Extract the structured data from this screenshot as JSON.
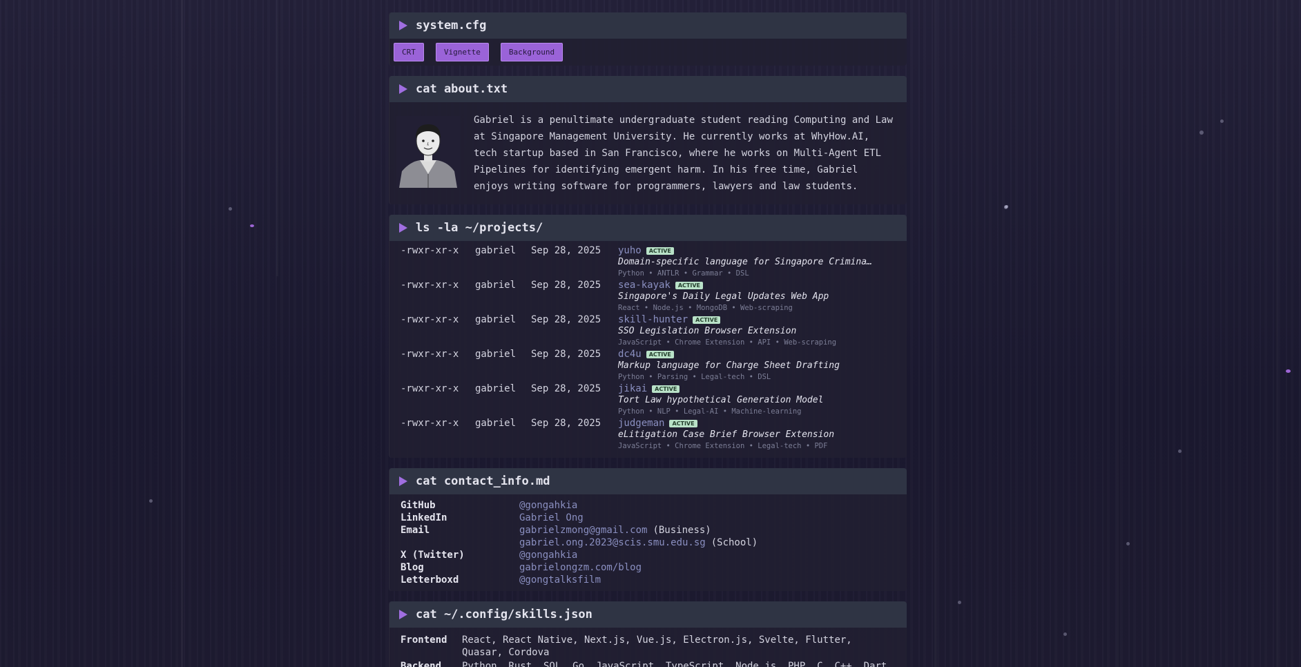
{
  "system_cfg": {
    "title": "system.cfg",
    "buttons": [
      {
        "label": "CRT"
      },
      {
        "label": "Vignette"
      },
      {
        "label": "Background"
      }
    ]
  },
  "about": {
    "title": "cat about.txt",
    "avatar_icon": "avatar-sketch",
    "text": "Gabriel is a penultimate undergraduate student reading Computing and Law at Singapore Management University. He currently works at WhyHow.AI, tech startup based in San Francisco, where he works on Multi-Agent ETL Pipelines for identifying emergent harm. In his free time, Gabriel enjoys writing software for programmers, lawyers and law students."
  },
  "projects": {
    "title": "ls -la ~/projects/",
    "badge_label": "ACTIVE",
    "rows": [
      {
        "perm": "-rwxr-xr-x",
        "owner": "gabriel",
        "date": "Sep 28, 2025",
        "name": "yuho",
        "desc": "Domain-specific language for Singapore Criminal Law",
        "tags": "Python • ANTLR • Grammar • DSL"
      },
      {
        "perm": "-rwxr-xr-x",
        "owner": "gabriel",
        "date": "Sep 28, 2025",
        "name": "sea-kayak",
        "desc": "Singapore's Daily Legal Updates Web App",
        "tags": "React • Node.js • MongoDB • Web-scraping"
      },
      {
        "perm": "-rwxr-xr-x",
        "owner": "gabriel",
        "date": "Sep 28, 2025",
        "name": "skill-hunter",
        "desc": "SSO Legislation Browser Extension",
        "tags": "JavaScript • Chrome Extension • API • Web-scraping"
      },
      {
        "perm": "-rwxr-xr-x",
        "owner": "gabriel",
        "date": "Sep 28, 2025",
        "name": "dc4u",
        "desc": "Markup language for Charge Sheet Drafting",
        "tags": "Python • Parsing • Legal-tech • DSL"
      },
      {
        "perm": "-rwxr-xr-x",
        "owner": "gabriel",
        "date": "Sep 28, 2025",
        "name": "jikai",
        "desc": "Tort Law hypothetical Generation Model",
        "tags": "Python • NLP • Legal-AI • Machine-learning"
      },
      {
        "perm": "-rwxr-xr-x",
        "owner": "gabriel",
        "date": "Sep 28, 2025",
        "name": "judgeman",
        "desc": "eLitigation Case Brief Browser Extension",
        "tags": "JavaScript • Chrome Extension • Legal-tech • PDF"
      }
    ]
  },
  "contact": {
    "title": "cat contact_info.md",
    "rows": [
      {
        "label": "GitHub",
        "value": "@gongahkia",
        "note": ""
      },
      {
        "label": "LinkedIn",
        "value": "Gabriel Ong",
        "note": ""
      },
      {
        "label": "Email",
        "value": "gabrielzmong@gmail.com",
        "note": "(Business)"
      },
      {
        "label": "",
        "value": "gabriel.ong.2023@scis.smu.edu.sg",
        "note": "(School)"
      },
      {
        "label": "X (Twitter)",
        "value": "@gongahkia",
        "note": ""
      },
      {
        "label": "Blog",
        "value": "gabrielongzm.com/blog",
        "note": ""
      },
      {
        "label": "Letterboxd",
        "value": "@gongtalksfilm",
        "note": ""
      }
    ]
  },
  "skills": {
    "title": "cat ~/.config/skills.json",
    "rows": [
      {
        "label": "Frontend",
        "value": "React, React Native, Next.js, Vue.js, Electron.js, Svelte, Flutter, Quasar, Cordova"
      },
      {
        "label": "Backend",
        "value": "Python, Rust, SQL, Go, JavaScript, TypeScript, Node.js, PHP, C, C++, Dart,"
      }
    ]
  },
  "colors": {
    "accent": "#9a63d8",
    "header_bg": "#2f3444",
    "link": "#8a8fc0",
    "badge_bg": "#b9e2c8"
  }
}
